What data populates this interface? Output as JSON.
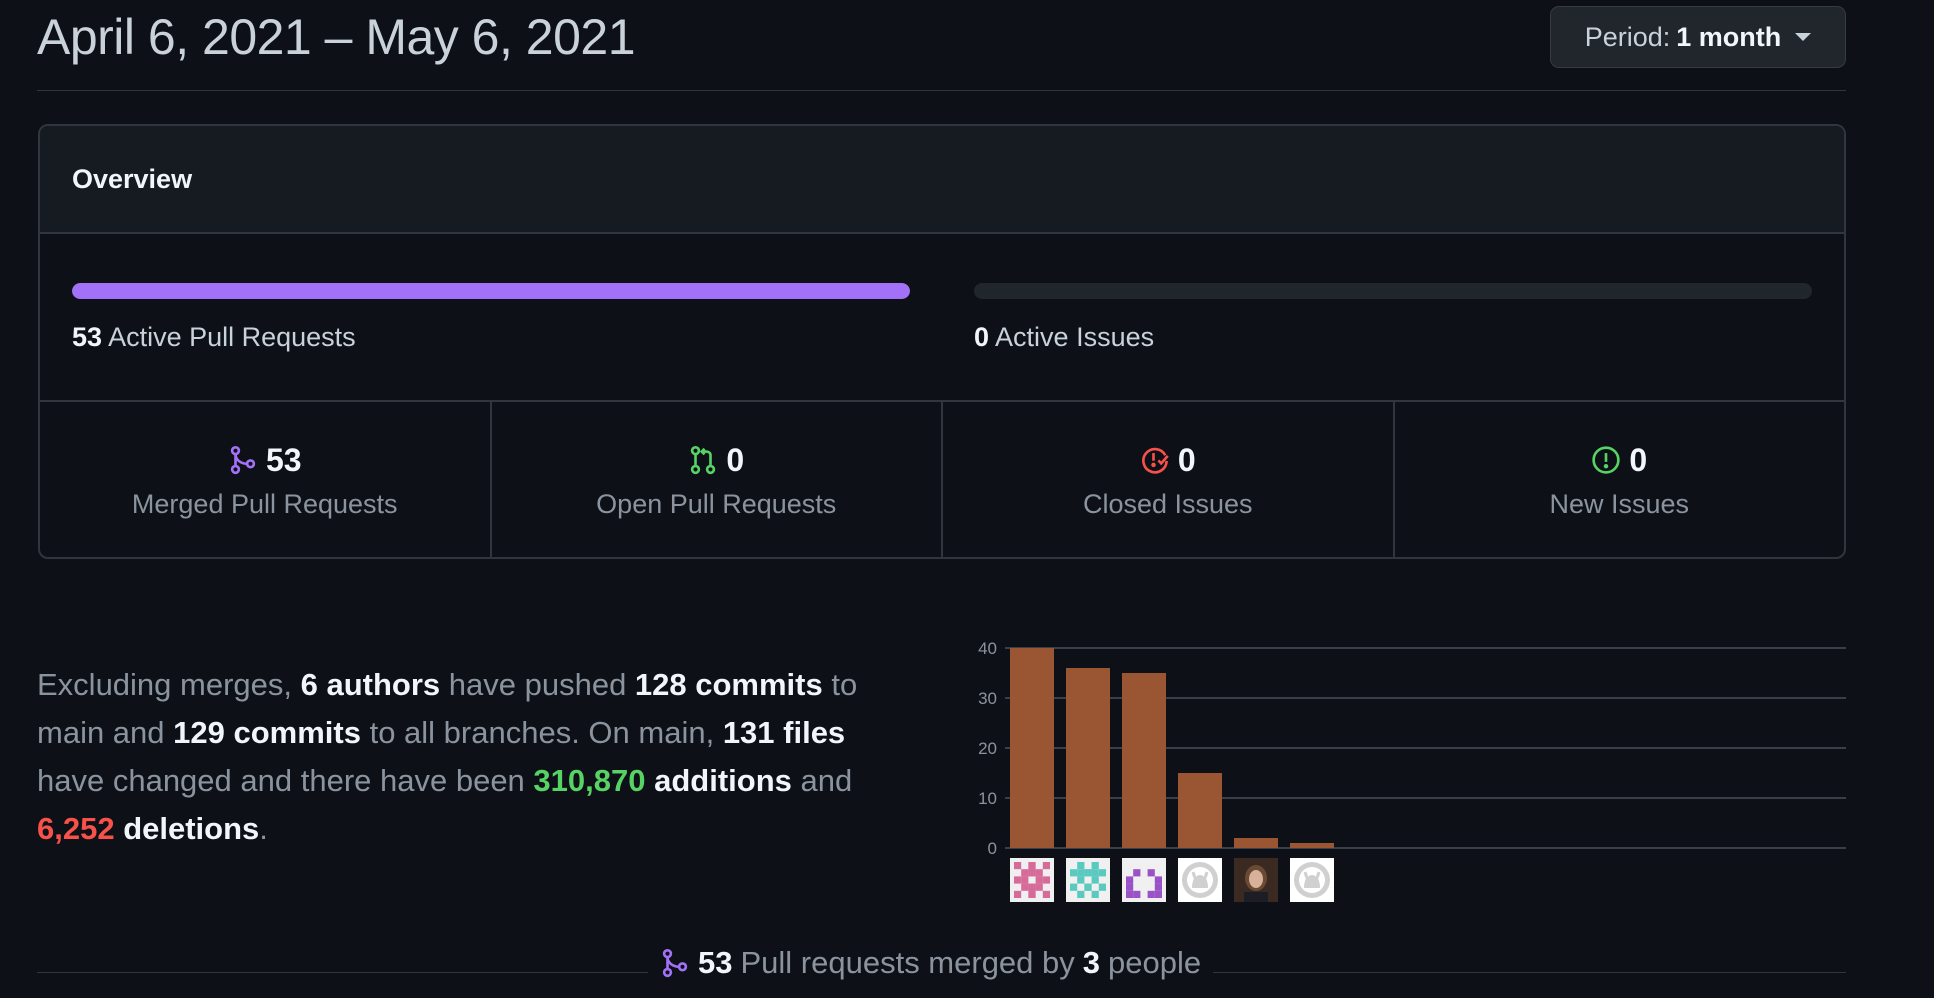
{
  "header": {
    "date_range": "April 6, 2021 – May 6, 2021",
    "period_label": "Period:",
    "period_value": "1 month"
  },
  "overview": {
    "title": "Overview",
    "active_pr_count": "53",
    "active_pr_label": "Active Pull Requests",
    "active_pr_fill": 1.0,
    "active_issues_count": "0",
    "active_issues_label": "Active Issues",
    "active_issues_fill": 0.0,
    "stats": [
      {
        "value": "53",
        "label": "Merged Pull Requests",
        "icon": "git-merge-icon",
        "color": "#a371f7"
      },
      {
        "value": "0",
        "label": "Open Pull Requests",
        "icon": "git-pull-request-icon",
        "color": "#56d364"
      },
      {
        "value": "0",
        "label": "Closed Issues",
        "icon": "issue-closed-icon",
        "color": "#f85149"
      },
      {
        "value": "0",
        "label": "New Issues",
        "icon": "issue-opened-icon",
        "color": "#56d364"
      }
    ]
  },
  "summary": {
    "p1": "Excluding merges, ",
    "authors": "6 authors",
    "p2": " have pushed ",
    "commits_main": "128 commits",
    "p3": " to main and ",
    "commits_all": "129 commits",
    "p4": " to all branches. On main, ",
    "files": "131 files",
    "p5": " have changed and there have been ",
    "additions_num": "310,870",
    "additions_word": "additions",
    "p6": " and ",
    "deletions_num": "6,252",
    "deletions_word": "deletions",
    "p7": "."
  },
  "chart_data": {
    "type": "bar",
    "categories": [
      "contributor-1",
      "contributor-2",
      "contributor-3",
      "contributor-4",
      "contributor-5",
      "contributor-6"
    ],
    "values": [
      40,
      36,
      35,
      15,
      2,
      1
    ],
    "ylim": [
      0,
      40
    ],
    "yticks": [
      0,
      10,
      20,
      30,
      40
    ],
    "bar_color": "#9a5632",
    "grid": true,
    "xlabel": "",
    "ylabel": ""
  },
  "contributors": [
    {
      "avatar_type": "identicon",
      "color": "#d66b9a"
    },
    {
      "avatar_type": "identicon",
      "color": "#5cc9c0"
    },
    {
      "avatar_type": "identicon",
      "color": "#9a52c7"
    },
    {
      "avatar_type": "github-default",
      "color": "#d0d0d0"
    },
    {
      "avatar_type": "photo",
      "color": "#6b4a35"
    },
    {
      "avatar_type": "github-default",
      "color": "#d0d0d0"
    }
  ],
  "merged_footer": {
    "count": "53",
    "mid_text": "Pull requests merged by",
    "people_count": "3",
    "people_word": "people"
  }
}
